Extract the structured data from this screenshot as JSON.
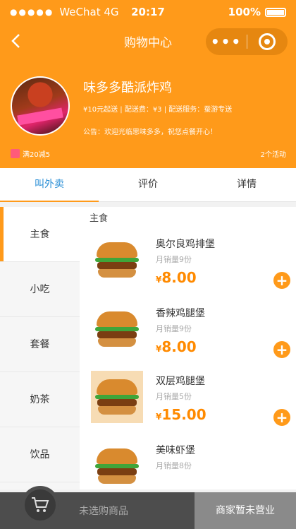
{
  "status_bar": {
    "carrier": "WeChat 4G",
    "time": "20:17",
    "battery": "100%"
  },
  "navbar": {
    "title": "购物中心"
  },
  "shop": {
    "name": "味多多酷派炸鸡",
    "info": "¥10元起送 | 配送费：¥3 | 配送服务：蚕游专送",
    "notice": "公告：欢迎光临思味多多，祝您点餐开心！",
    "promo": "满20减5",
    "activity_count": "2个活动"
  },
  "tabs": [
    {
      "label": "叫外卖",
      "active": true
    },
    {
      "label": "评价",
      "active": false
    },
    {
      "label": "详情",
      "active": false
    }
  ],
  "categories": [
    {
      "label": "主食",
      "active": true
    },
    {
      "label": "小吃",
      "active": false
    },
    {
      "label": "套餐",
      "active": false
    },
    {
      "label": "奶茶",
      "active": false
    },
    {
      "label": "饮品",
      "active": false
    }
  ],
  "section_title": "主食",
  "items": [
    {
      "name": "奥尔良鸡排堡",
      "sales": "月销量9份",
      "currency": "¥",
      "price": "8.00"
    },
    {
      "name": "香辣鸡腿堡",
      "sales": "月销量9份",
      "currency": "¥",
      "price": "8.00"
    },
    {
      "name": "双层鸡腿堡",
      "sales": "月销量5份",
      "currency": "¥",
      "price": "15.00"
    },
    {
      "name": "美味虾堡",
      "sales": "月销量8份",
      "currency": "¥",
      "price": ""
    }
  ],
  "cart": {
    "empty_text": "未选购商品",
    "closed_text": "商家暂未营业"
  },
  "colors": {
    "brand": "#ff9a1a",
    "active_tab": "#2b8fd6",
    "price": "#ff8a00"
  }
}
